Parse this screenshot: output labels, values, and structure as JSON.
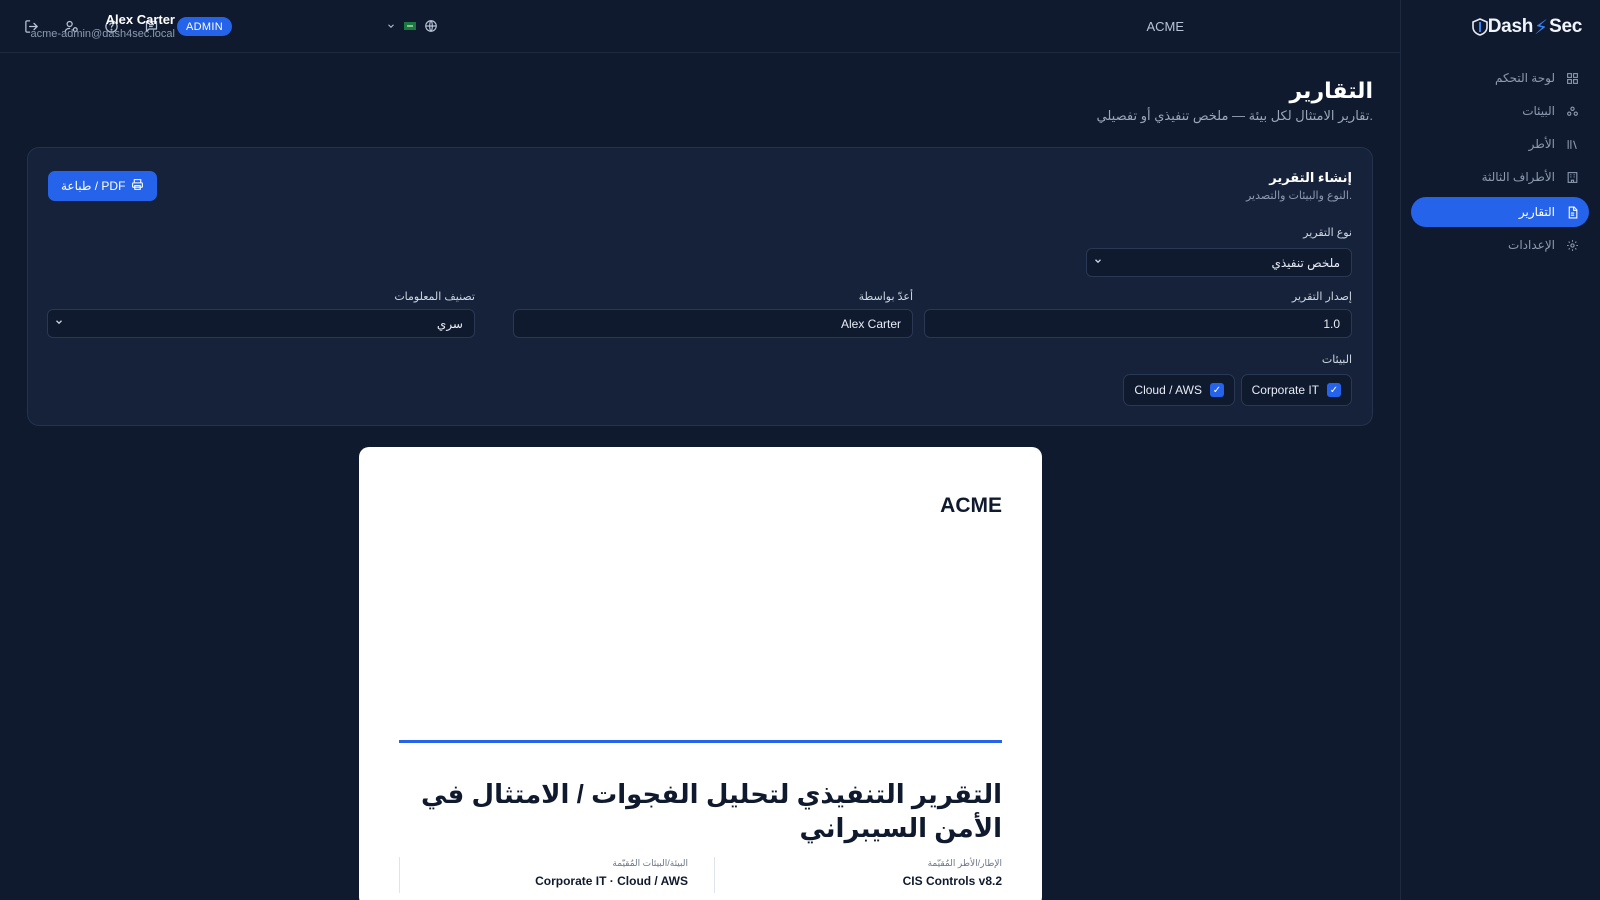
{
  "topbar": {
    "icons": [
      "logout-icon",
      "user-settings-icon",
      "help-icon",
      "chat-icon"
    ],
    "role_badge": "ADMIN",
    "user_name": "Alex Carter",
    "user_email": "acme-admin@dash4sec.local",
    "tenant": "ACME"
  },
  "sidebar": {
    "logo_left": "Dash",
    "logo_right": "Sec",
    "items": [
      {
        "label": "لوحة التحكم",
        "icon": "grid-icon",
        "active": false
      },
      {
        "label": "البيئات",
        "icon": "environments-icon",
        "active": false
      },
      {
        "label": "الأطر",
        "icon": "library-icon",
        "active": false
      },
      {
        "label": "الأطراف الثالثة",
        "icon": "building-icon",
        "active": false
      },
      {
        "label": "التقارير",
        "icon": "report-icon",
        "active": true
      },
      {
        "label": "الإعدادات",
        "icon": "gear-icon",
        "active": false
      }
    ]
  },
  "page": {
    "title": "التقارير",
    "subtitle": "تقارير الامتثال لكل بيئة — ملخص تنفيذي أو تفصيلي."
  },
  "builder": {
    "title": "إنشاء التقرير",
    "subtitle": "النوع والبيئات والتصدير.",
    "print_label": "طباعة / PDF",
    "report_type_label": "نوع التقرير",
    "report_type_value": "ملخص تنفيذي",
    "version_label": "إصدار التقرير",
    "version_value": "1.0",
    "prepared_by_label": "أعدّ بواسطة",
    "prepared_by_value": "Alex Carter",
    "classification_label": "تصنيف المعلومات",
    "classification_value": "سري",
    "environments_label": "البيئات",
    "environments": [
      "Corporate IT",
      "Cloud / AWS"
    ]
  },
  "preview": {
    "brand": "ACME",
    "title": "التقرير التنفيذي لتحليل الفجوات / الامتثال في الأمن السيبراني",
    "framework_label": "الإطار/الأطر المُقيّمة",
    "framework_value": "CIS Controls v8.2",
    "environment_label": "البيئة/البيئات المُقيّمة",
    "environment_value": "Corporate IT · Cloud / AWS"
  },
  "colors": {
    "background": "#0f1a2e",
    "card": "#15223a",
    "accent": "#2563eb"
  }
}
